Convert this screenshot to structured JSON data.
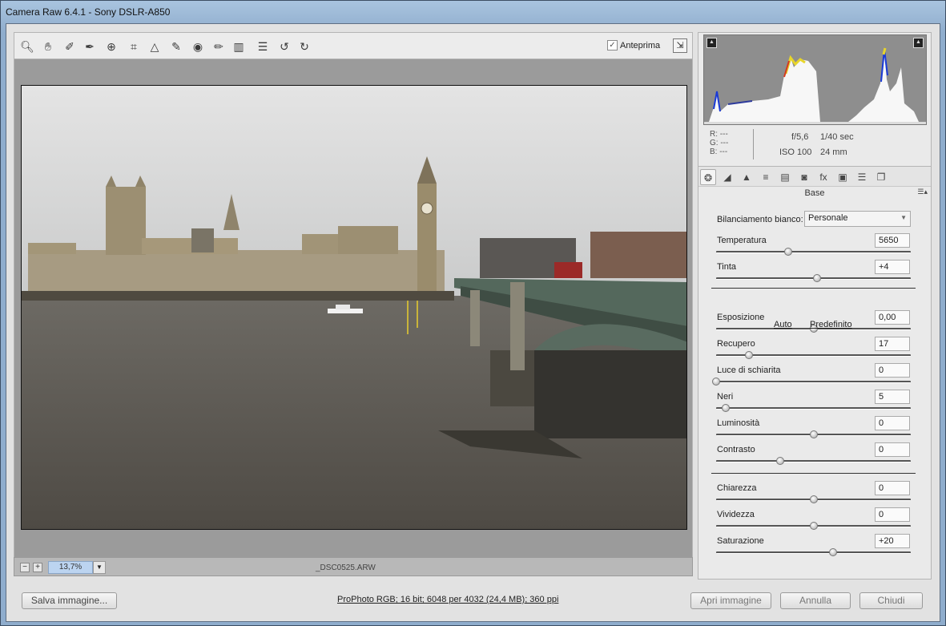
{
  "window": {
    "title": "Camera Raw 6.4.1  -  Sony DSLR-A850"
  },
  "toolbar": {
    "tools": [
      "zoom-tool-icon",
      "hand-tool-icon",
      "white-balance-tool-icon",
      "color-sampler-icon",
      "targeted-adjustment-icon",
      "crop-tool-icon",
      "straighten-tool-icon",
      "spot-removal-icon",
      "red-eye-icon",
      "adjustment-brush-icon",
      "graduated-filter-icon",
      "preferences-icon",
      "rotate-left-icon",
      "rotate-right-icon"
    ],
    "preview_label": "Anteprima",
    "preview_checked": true
  },
  "zoombar": {
    "zoom_value": "13,7%",
    "filename": "_DSC0525.ARW"
  },
  "info": {
    "r": "R:   ---",
    "g": "G:   ---",
    "b": "B:   ---",
    "aperture": "f/5,6",
    "shutter": "1/40 sec",
    "iso": "ISO 100",
    "focal": "24 mm"
  },
  "panel": {
    "section_title": "Base",
    "white_balance_label": "Bilanciamento bianco:",
    "white_balance_value": "Personale",
    "auto_label": "Auto",
    "default_label": "Predefinito",
    "sliders": [
      {
        "label": "Temperatura",
        "value": "5650",
        "level": 0.37
      },
      {
        "label": "Tinta",
        "value": "+4",
        "level": 0.52
      },
      {
        "label": "Esposizione",
        "value": "0,00",
        "level": 0.5
      },
      {
        "label": "Recupero",
        "value": "17",
        "level": 0.17
      },
      {
        "label": "Luce di schiarita",
        "value": "0",
        "level": 0.0
      },
      {
        "label": "Neri",
        "value": "5",
        "level": 0.05
      },
      {
        "label": "Luminosità",
        "value": "0",
        "level": 0.5
      },
      {
        "label": "Contrasto",
        "value": "0",
        "level": 0.33
      },
      {
        "label": "Chiarezza",
        "value": "0",
        "level": 0.5
      },
      {
        "label": "Vividezza",
        "value": "0",
        "level": 0.5
      },
      {
        "label": "Saturazione",
        "value": "+20",
        "level": 0.6
      }
    ]
  },
  "footer": {
    "save_label": "Salva immagine...",
    "workflow_text": "ProPhoto RGB; 16 bit; 6048 per 4032 (24,4 MB); 360 ppi",
    "open_label": "Apri immagine",
    "cancel_label": "Annulla",
    "done_label": "Chiudi"
  }
}
